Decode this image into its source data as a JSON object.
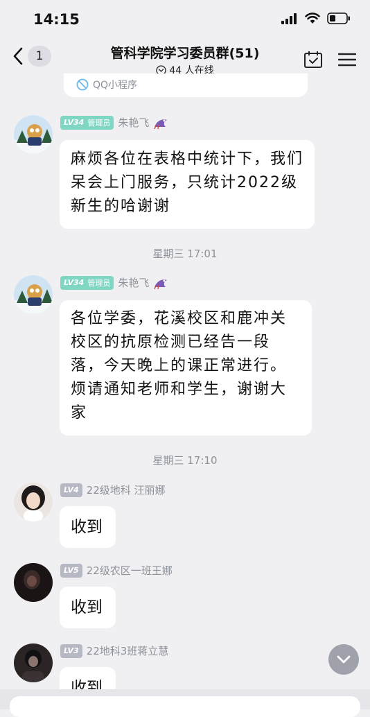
{
  "status_bar": {
    "time": "14:15"
  },
  "header": {
    "back_badge": "1",
    "title": "管科学院学习委员群(51)",
    "online": "44 人在线"
  },
  "previous_card": {
    "label": "QQ小程序"
  },
  "messages": [
    {
      "level": "LV34",
      "role": "管理员",
      "sender": "朱艳飞",
      "text": "麻烦各位在表格中统计下，我们呆会上门服务，只统计2022级新生的哈谢谢"
    },
    {
      "level": "LV34",
      "role": "管理员",
      "sender": "朱艳飞",
      "text": "各位学委，花溪校区和鹿冲关校区的抗原检测已经告一段落，今天晚上的课正常进行。烦请通知老师和学生，谢谢大家"
    },
    {
      "level": "LV4",
      "sender": "22级地科 汪丽娜",
      "text": "收到"
    },
    {
      "level": "LV5",
      "sender": "22级农区一班王娜",
      "text": "收到"
    },
    {
      "level": "LV3",
      "sender": "22地科3班蒋立慧",
      "text": "收到"
    }
  ],
  "timestamps": [
    "星期三 17:01",
    "星期三 17:10"
  ],
  "colors": {
    "background": "#f0f0f3",
    "admin_badge": "#7fd6c3",
    "level_badge": "#b6b9c4"
  }
}
